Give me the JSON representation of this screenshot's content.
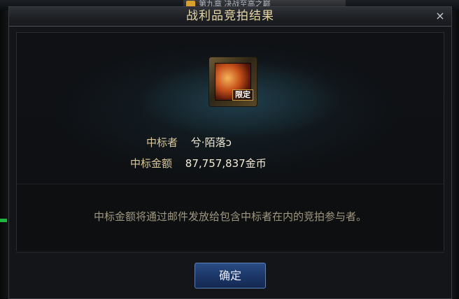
{
  "background": {
    "tab_text": "第九章 决战至高之巅"
  },
  "dialog": {
    "title": "战利品竞拍结果",
    "close_glyph": "×",
    "item": {
      "icon": "item-orb-icon",
      "badge": "限定"
    },
    "winner_label": "中标者",
    "winner_name": "兮·陌落ɔ",
    "amount_label": "中标金额",
    "amount_value": "87,757,837金币",
    "notice": "中标金额将通过邮件发放给包含中标者在内的竞拍参与者。",
    "confirm_label": "确定"
  },
  "colors": {
    "title": "#e6d7a6",
    "label": "#d9c898",
    "button": "#1b3565",
    "status_green": "#1fb63f"
  }
}
